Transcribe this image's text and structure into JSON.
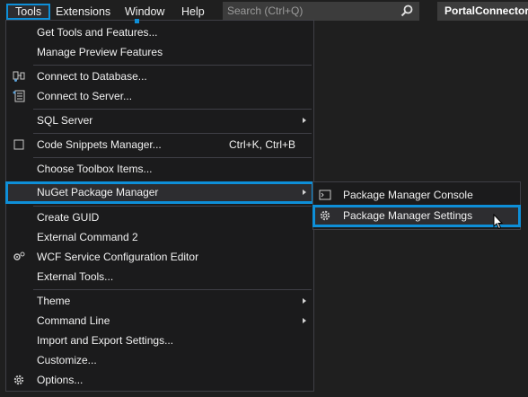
{
  "menubar": {
    "items": [
      "Tools",
      "Extensions",
      "Window",
      "Help"
    ],
    "search_placeholder": "Search (Ctrl+Q)",
    "solution_name": "PortalConnector"
  },
  "tools_menu": {
    "get_tools": "Get Tools and Features...",
    "manage_preview": "Manage Preview Features",
    "connect_db": "Connect to Database...",
    "connect_server": "Connect to Server...",
    "sql_server": "SQL Server",
    "code_snippets": "Code Snippets Manager...",
    "code_snippets_shortcut": "Ctrl+K, Ctrl+B",
    "choose_toolbox": "Choose Toolbox Items...",
    "nuget": "NuGet Package Manager",
    "create_guid": "Create GUID",
    "external_cmd2": "External Command 2",
    "wcf_editor": "WCF Service Configuration Editor",
    "external_tools": "External Tools...",
    "theme": "Theme",
    "command_line": "Command Line",
    "import_export": "Import and Export Settings...",
    "customize": "Customize...",
    "options": "Options..."
  },
  "nuget_submenu": {
    "console": "Package Manager Console",
    "settings": "Package Manager Settings"
  },
  "colors": {
    "accent": "#0e8fd8",
    "menu_bg": "#1b1b1c",
    "highlight_bg": "#2d2d30"
  }
}
